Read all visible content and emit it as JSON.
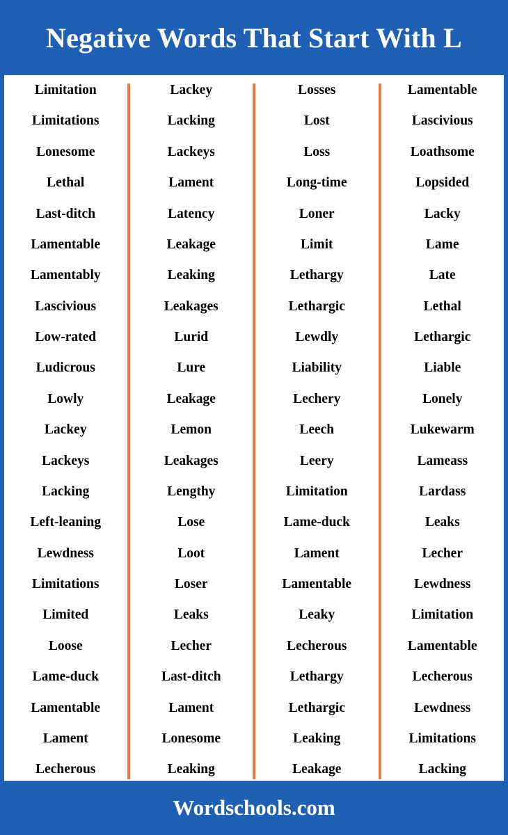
{
  "header": {
    "title": "Negative Words That Start With L",
    "background_color": "#1f5fb4",
    "text_color": "#ffffff"
  },
  "footer": {
    "text": "Wordschools.com",
    "background_color": "#1f5fb4",
    "text_color": "#ffffff"
  },
  "theme": {
    "divider_color": "#ef7a3c",
    "page_background": "#ffffff",
    "word_color": "#000000"
  },
  "columns": [
    {
      "words": [
        "Limitation",
        "Limitations",
        "Lonesome",
        "Lethal",
        "Last-ditch",
        "Lamentable",
        "Lamentably",
        "Lascivious",
        "Low-rated",
        "Ludicrous",
        "Lowly",
        "Lackey",
        "Lackeys",
        "Lacking",
        "Left-leaning",
        "Lewdness",
        "Limitations",
        "Limited",
        "Loose",
        "Lame-duck",
        "Lamentable",
        "Lament",
        "Lecherous"
      ]
    },
    {
      "words": [
        "Lackey",
        "Lacking",
        "Lackeys",
        "Lament",
        "Latency",
        "Leakage",
        "Leaking",
        "Leakages",
        "Lurid",
        "Lure",
        "Leakage",
        "Lemon",
        "Leakages",
        "Lengthy",
        "Lose",
        "Loot",
        "Loser",
        "Leaks",
        "Lecher",
        "Last-ditch",
        "Lament",
        "Lonesome",
        "Leaking"
      ]
    },
    {
      "words": [
        "Losses",
        "Lost",
        "Loss",
        "Long-time",
        "Loner",
        "Limit",
        "Lethargy",
        "Lethargic",
        "Lewdly",
        "Liability",
        "Lechery",
        "Leech",
        "Leery",
        "Limitation",
        "Lame-duck",
        "Lament",
        "Lamentable",
        "Leaky",
        "Lecherous",
        "Lethargy",
        "Lethargic",
        "Leaking",
        "Leakage"
      ]
    },
    {
      "words": [
        "Lamentable",
        "Lascivious",
        "Loathsome",
        "Lopsided",
        "Lacky",
        "Lame",
        "Late",
        "Lethal",
        "Lethargic",
        "Liable",
        "Lonely",
        "Lukewarm",
        "Lameass",
        "Lardass",
        "Leaks",
        "Lecher",
        "Lewdness",
        "Limitation",
        "Lamentable",
        "Lecherous",
        "Lewdness",
        "Limitations",
        "Lacking"
      ]
    }
  ]
}
